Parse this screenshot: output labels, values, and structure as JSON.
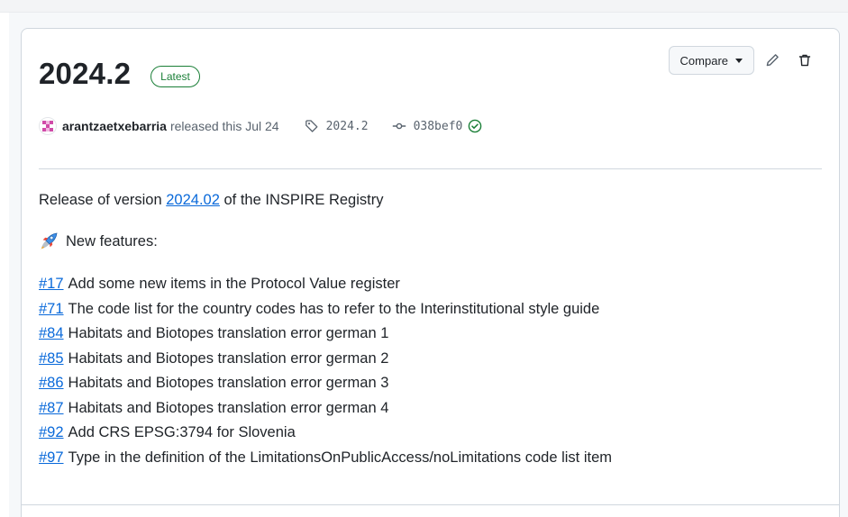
{
  "release": {
    "title": "2024.2",
    "badge": "Latest",
    "compare_label": "Compare",
    "author": "arantzaetxebarria",
    "released_text": "released this Jul 24",
    "tag": "2024.2",
    "commit": "038bef0"
  },
  "body": {
    "intro_prefix": "Release of version ",
    "intro_link": "2024.02",
    "intro_suffix": " of the INSPIRE Registry",
    "features_heading": "New features:",
    "issues": [
      {
        "number": "#17",
        "text": "Add some new items in the Protocol Value register"
      },
      {
        "number": "#71",
        "text": "The code list for the country codes has to refer to the Interinstitutional style guide"
      },
      {
        "number": "#84",
        "text": "Habitats and Biotopes translation error german 1"
      },
      {
        "number": "#85",
        "text": "Habitats and Biotopes translation error german 2"
      },
      {
        "number": "#86",
        "text": "Habitats and Biotopes translation error german 3"
      },
      {
        "number": "#87",
        "text": "Habitats and Biotopes translation error german 4"
      },
      {
        "number": "#92",
        "text": "Add CRS EPSG:3794 for Slovenia"
      },
      {
        "number": "#97",
        "text": "Type in the definition of the LimitationsOnPublicAccess/noLimitations code list item"
      }
    ]
  },
  "icons": {
    "features": "rocket-icon",
    "tag": "tag-icon",
    "commit": "git-commit-icon",
    "verified": "check-circle-icon",
    "edit": "pencil-icon",
    "delete": "trash-icon"
  },
  "colors": {
    "link": "#0969da",
    "badge": "#1a7f37",
    "border": "#d0d7de",
    "text": "#1f2328",
    "muted": "#59636e"
  }
}
